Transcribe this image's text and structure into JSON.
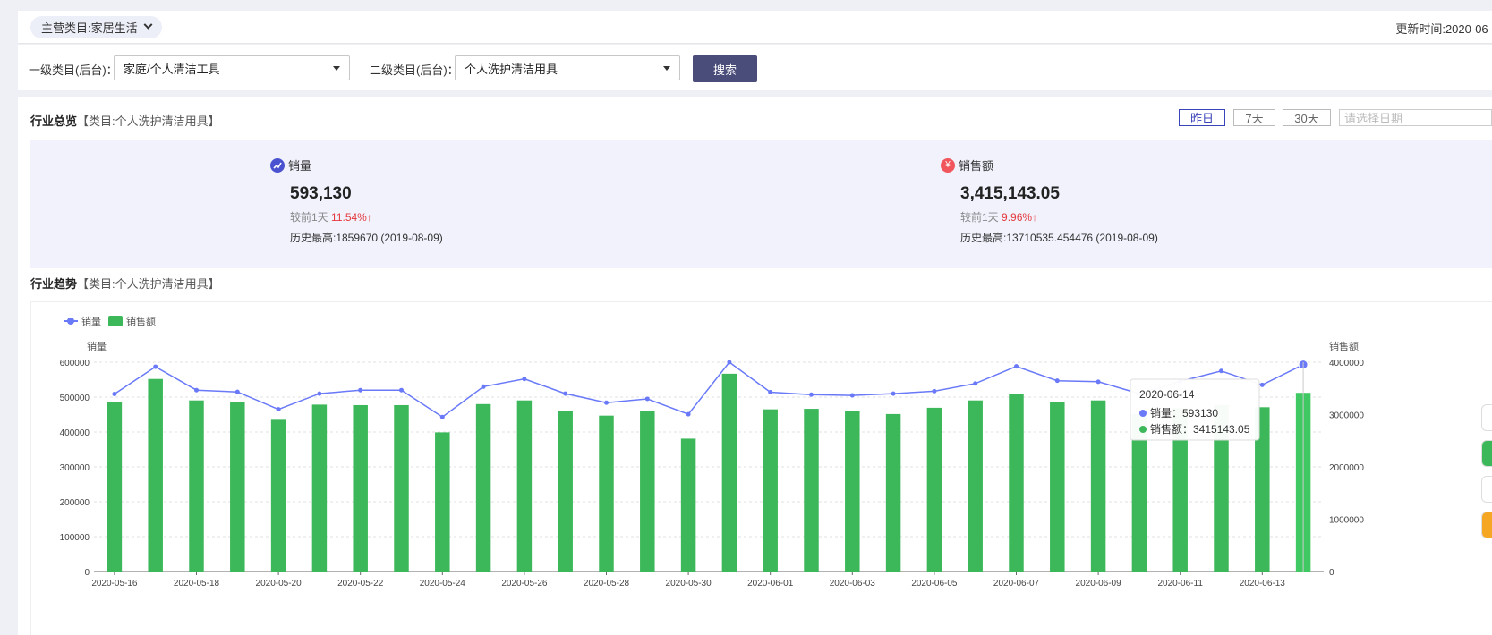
{
  "header": {
    "main_category": "主营类目:家居生活",
    "update_time": "更新时间:2020-06-"
  },
  "filters": {
    "level1_label": "一级类目(后台)：",
    "level1_value": "家庭/个人清洁工具",
    "level2_label": "二级类目(后台)：",
    "level2_value": "个人洗护清洁用具",
    "search_label": "搜索"
  },
  "overview": {
    "title": "行业总览",
    "subtitle": "【类目:个人洗护清洁用具】",
    "ranges": [
      "昨日",
      "7天",
      "30天"
    ],
    "date_placeholder": "请选择日期",
    "stats": [
      {
        "label": "销量",
        "icon": "trend-icon",
        "color": "#4a52d0",
        "value": "593,130",
        "compare_prefix": "较前1天",
        "compare_pct": "11.54%",
        "compare_arrow": "↑",
        "history": "历史最高:1859670 (2019-08-09)"
      },
      {
        "label": "销售额",
        "icon": "yen-icon",
        "color": "#f0565b",
        "value": "3,415,143.05",
        "compare_prefix": "较前1天",
        "compare_pct": "9.96%",
        "compare_arrow": "↑",
        "history": "历史最高:13710535.454476 (2019-08-09)"
      }
    ]
  },
  "trend": {
    "title": "行业趋势",
    "subtitle": "【类目:个人洗护清洁用具】"
  },
  "tooltip": {
    "date": "2020-06-14",
    "line1": "销量：593130",
    "line2": "销售额：3415143.05"
  },
  "chart_data": {
    "type": "bar",
    "legend": [
      "销量",
      "销售额"
    ],
    "legend_position": "top-left",
    "grid": true,
    "y_left": {
      "label": "销量",
      "ticks": [
        "0",
        "100000",
        "200000",
        "300000",
        "400000",
        "500000",
        "600000"
      ],
      "range": [
        0,
        600000
      ]
    },
    "y_right": {
      "label": "销售额",
      "ticks": [
        "0",
        "1000000",
        "2000000",
        "3000000",
        "4000000"
      ],
      "range": [
        0,
        4000000
      ]
    },
    "x_ticks": [
      "2020-05-16",
      "2020-05-18",
      "2020-05-20",
      "2020-05-22",
      "2020-05-24",
      "2020-05-26",
      "2020-05-28",
      "2020-05-30",
      "2020-06-01",
      "2020-06-03",
      "2020-06-05",
      "2020-06-07",
      "2020-06-09",
      "2020-06-11",
      "2020-06-13"
    ],
    "categories": [
      "2020-05-16",
      "2020-05-17",
      "2020-05-18",
      "2020-05-19",
      "2020-05-20",
      "2020-05-21",
      "2020-05-22",
      "2020-05-23",
      "2020-05-24",
      "2020-05-25",
      "2020-05-26",
      "2020-05-27",
      "2020-05-28",
      "2020-05-29",
      "2020-05-30",
      "2020-05-31",
      "2020-06-01",
      "2020-06-02",
      "2020-06-03",
      "2020-06-04",
      "2020-06-05",
      "2020-06-06",
      "2020-06-07",
      "2020-06-08",
      "2020-06-09",
      "2020-06-10",
      "2020-06-11",
      "2020-06-12",
      "2020-06-13",
      "2020-06-14"
    ],
    "series": [
      {
        "name": "销量",
        "type": "line",
        "axis": "left",
        "color": "#6979f8",
        "values": [
          509000,
          587000,
          520000,
          515000,
          465000,
          510000,
          520000,
          520000,
          443000,
          530000,
          552000,
          510000,
          484000,
          495000,
          451000,
          600000,
          514000,
          507000,
          505000,
          510000,
          517000,
          539000,
          588000,
          547000,
          544000,
          510000,
          545000,
          575000,
          535000,
          593130
        ]
      },
      {
        "name": "销售额",
        "type": "bar",
        "axis": "right",
        "color": "#3cb85a",
        "values": [
          3240000,
          3680000,
          3270000,
          3240000,
          2900000,
          3190000,
          3180000,
          3180000,
          2660000,
          3200000,
          3270000,
          3070000,
          2980000,
          3060000,
          2540000,
          3780000,
          3100000,
          3110000,
          3060000,
          3010000,
          3130000,
          3270000,
          3400000,
          3240000,
          3270000,
          3010000,
          3120000,
          3180000,
          3140000,
          3415143.05
        ]
      }
    ]
  }
}
